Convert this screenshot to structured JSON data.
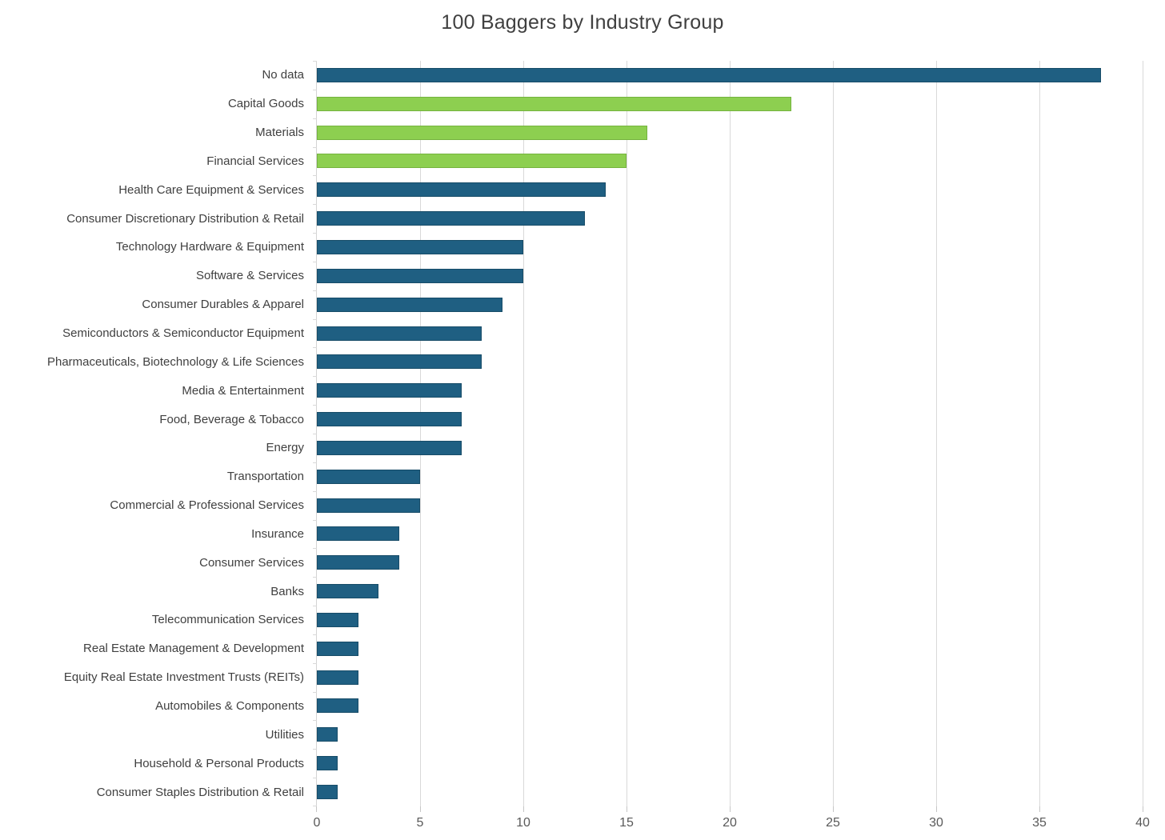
{
  "chart_data": {
    "type": "bar",
    "orientation": "horizontal",
    "title": "100 Baggers by Industry Group",
    "xlabel": "",
    "ylabel": "",
    "xlim": [
      0,
      40
    ],
    "x_ticks": [
      0,
      5,
      10,
      15,
      20,
      25,
      30,
      35,
      40
    ],
    "grid": "vertical-only",
    "legend": "none",
    "categories": [
      "No data",
      "Capital Goods",
      "Materials",
      "Financial Services",
      "Health Care Equipment & Services",
      "Consumer Discretionary Distribution & Retail",
      "Technology Hardware & Equipment",
      "Software & Services",
      "Consumer Durables & Apparel",
      "Semiconductors & Semiconductor Equipment",
      "Pharmaceuticals, Biotechnology & Life Sciences",
      "Media & Entertainment",
      "Food, Beverage & Tobacco",
      "Energy",
      "Transportation",
      "Commercial & Professional Services",
      "Insurance",
      "Consumer Services",
      "Banks",
      "Telecommunication Services",
      "Real Estate Management & Development",
      "Equity Real Estate Investment Trusts (REITs)",
      "Automobiles & Components",
      "Utilities",
      "Household & Personal Products",
      "Consumer Staples Distribution & Retail"
    ],
    "values": [
      38,
      23,
      16,
      15,
      14,
      13,
      10,
      10,
      9,
      8,
      8,
      7,
      7,
      7,
      5,
      5,
      4,
      4,
      3,
      2,
      2,
      2,
      2,
      1,
      1,
      1
    ],
    "highlighted_categories": [
      "Capital Goods",
      "Materials",
      "Financial Services"
    ],
    "colors": {
      "bar_default": "#1F5F82",
      "bar_default_border": "#174C68",
      "bar_highlight": "#8DCF50",
      "bar_highlight_border": "#75B33F",
      "gridline": "#D9D9D9",
      "axis_line": "#D4D4D4",
      "tick_mark": "#C6C6C6",
      "title_text": "#404040",
      "label_text": "#404040",
      "tick_text": "#595959"
    }
  }
}
